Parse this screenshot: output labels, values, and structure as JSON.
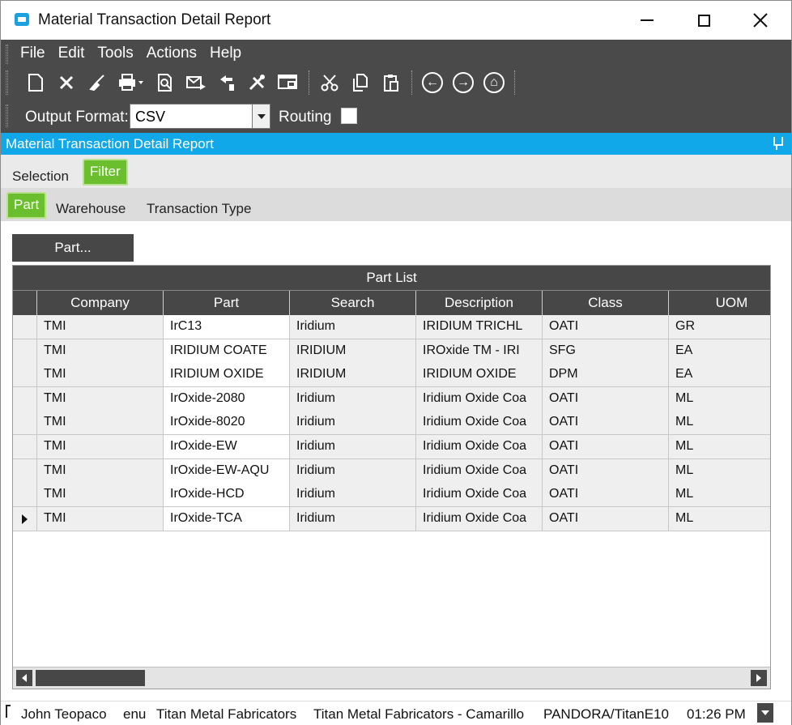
{
  "window": {
    "title": "Material Transaction Detail Report"
  },
  "menu": [
    "File",
    "Edit",
    "Tools",
    "Actions",
    "Help"
  ],
  "toolbar": {
    "icons": [
      "new-icon",
      "delete-icon",
      "clear-icon",
      "print-icon",
      "print-preview-icon",
      "email-icon",
      "attach-icon",
      "tools-icon",
      "screen-capture-icon",
      "cut-icon",
      "copy-icon",
      "paste-icon",
      "back-icon",
      "forward-icon",
      "home-icon"
    ]
  },
  "output": {
    "label": "Output Format:",
    "value": "CSV",
    "routing_label": "Routing"
  },
  "report_header": "Material Transaction Detail Report",
  "tabs_top": {
    "selection": "Selection",
    "filter": "Filter"
  },
  "tabs_filter": {
    "part": "Part",
    "warehouse": "Warehouse",
    "transaction_type": "Transaction Type"
  },
  "part_button": "Part...",
  "grid": {
    "caption": "Part List",
    "columns": [
      "Company",
      "Part",
      "Search",
      "Description",
      "Class",
      "UOM"
    ],
    "rows": [
      [
        "TMI",
        "IrC13",
        "Iridium",
        "IRIDIUM TRICHL",
        "OATI",
        "GR"
      ],
      [
        "TMI",
        "IRIDIUM COATE",
        "IRIDIUM",
        "IROxide TM - IRI",
        "SFG",
        "EA"
      ],
      [
        "TMI",
        "IRIDIUM OXIDE",
        "IRIDIUM",
        "IRIDIUM OXIDE",
        "DPM",
        "EA"
      ],
      [
        "TMI",
        "IrOxide-2080",
        "Iridium",
        "Iridium Oxide Coa",
        "OATI",
        "ML"
      ],
      [
        "TMI",
        "IrOxide-8020",
        "Iridium",
        "Iridium Oxide Coa",
        "OATI",
        "ML"
      ],
      [
        "TMI",
        "IrOxide-EW",
        "Iridium",
        "Iridium Oxide Coa",
        "OATI",
        "ML"
      ],
      [
        "TMI",
        "IrOxide-EW-AQU",
        "Iridium",
        "Iridium Oxide Coa",
        "OATI",
        "ML"
      ],
      [
        "TMI",
        "IrOxide-HCD",
        "Iridium",
        "Iridium Oxide Coa",
        "OATI",
        "ML"
      ],
      [
        "TMI",
        "IrOxide-TCA",
        "Iridium",
        "Iridium Oxide Coa",
        "OATI",
        "ML"
      ]
    ],
    "current_row": 8
  },
  "status": {
    "user": "John Teopaco",
    "language": "enu",
    "company": "Titan Metal Fabricators",
    "site": "Titan Metal Fabricators - Camarillo",
    "server": "PANDORA/TitanE10",
    "time": "01:26 PM"
  },
  "colors": {
    "accent_blue": "#10a8e8",
    "tab_green": "#6bbf2e",
    "dark_bar": "#4a4a4a"
  }
}
